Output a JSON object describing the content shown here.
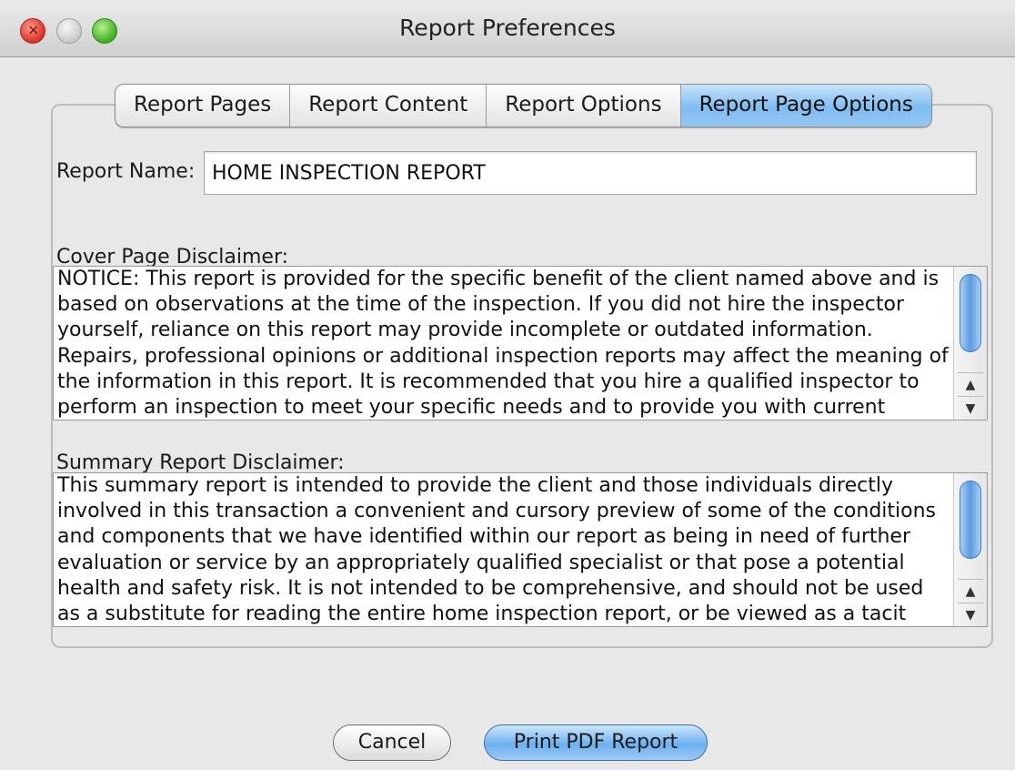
{
  "window": {
    "title": "Report Preferences"
  },
  "tabs": [
    {
      "label": "Report Pages",
      "selected": false
    },
    {
      "label": "Report Content",
      "selected": false
    },
    {
      "label": "Report Options",
      "selected": false
    },
    {
      "label": "Report Page Options",
      "selected": true
    }
  ],
  "report_name": {
    "label": "Report Name:",
    "value": "HOME INSPECTION REPORT"
  },
  "cover_disclaimer": {
    "label": "Cover Page Disclaimer:",
    "text": "NOTICE: This report is provided for the specific benefit of the client named above and is based on observations at the time of the inspection. If you did not hire the inspector yourself, reliance on this report may provide incomplete or outdated information. Repairs, professional opinions or additional inspection reports may affect the meaning of the information in this report. It is recommended that you hire a qualified inspector to perform an inspection to meet your specific needs and to provide you with current"
  },
  "summary_disclaimer": {
    "label": "Summary Report Disclaimer:",
    "text": "This summary report is intended to provide the client and those individuals directly involved in this transaction a convenient and cursory preview of some of the conditions and components that we have identified within our report as being in need of further evaluation or service by an appropriately qualified specialist or that pose a potential health and safety risk. It is not intended to be comprehensive, and should not be used as a substitute for reading the entire home inspection report, or be viewed as a tacit"
  },
  "buttons": {
    "cancel": "Cancel",
    "print": "Print PDF Report"
  },
  "colors": {
    "accent": "#7fbcf1",
    "close": "#d8312a",
    "zoom": "#3fae20"
  }
}
